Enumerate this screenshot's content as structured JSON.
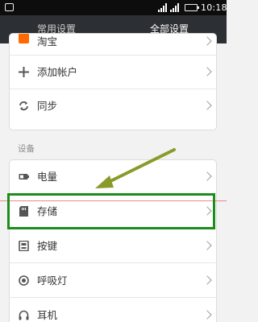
{
  "status_bar": {
    "time": "10:18"
  },
  "tabs": [
    {
      "label": "常用设置"
    },
    {
      "label": "全部设置"
    }
  ],
  "card1": {
    "items": [
      {
        "label": "淘宝",
        "icon": "taobao-icon"
      },
      {
        "label": "添加帐户",
        "icon": "plus-icon"
      },
      {
        "label": "同步",
        "icon": "sync-icon"
      }
    ]
  },
  "section": {
    "header": "设备"
  },
  "card2": {
    "items": [
      {
        "label": "电量",
        "icon": "battery-icon"
      },
      {
        "label": "存储",
        "icon": "sd-card-icon"
      },
      {
        "label": "按键",
        "icon": "key-icon"
      },
      {
        "label": "呼吸灯",
        "icon": "breathing-light-icon"
      },
      {
        "label": "耳机",
        "icon": "headphones-icon"
      }
    ]
  },
  "colors": {
    "tab_bar": "#2c2f33",
    "highlight": "#1c8c1c",
    "arrow": "#8a9a2a"
  }
}
